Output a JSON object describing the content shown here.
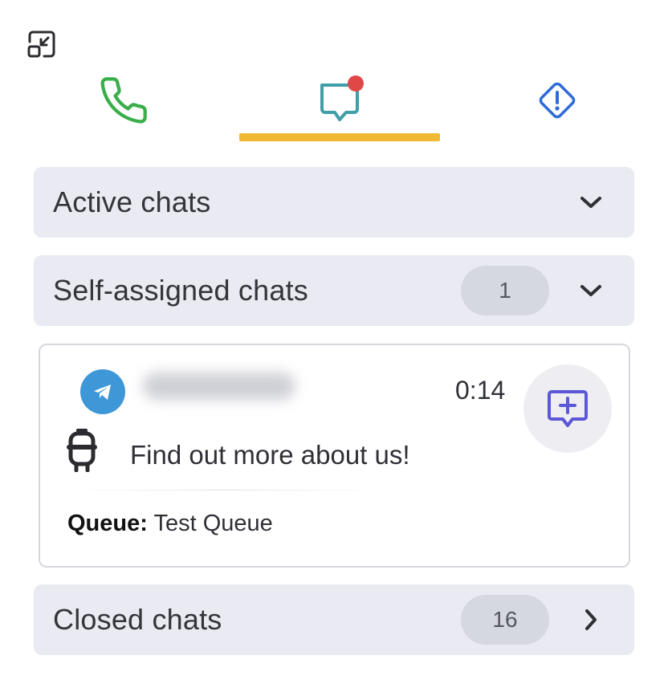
{
  "toolbar": {
    "collapse_icon": "minimize-window-icon"
  },
  "tabs": [
    {
      "name": "phone",
      "icon": "phone-icon",
      "color": "#3aae4a"
    },
    {
      "name": "chats",
      "icon": "chat-bubble-icon",
      "color": "#3f9ea8",
      "badge_color": "#e04848",
      "active": true
    },
    {
      "name": "alerts",
      "icon": "alert-diamond-icon",
      "color": "#2f6bd6"
    }
  ],
  "accent_color": "#f0b833",
  "sections": {
    "active": {
      "title": "Active chats",
      "expanded": false
    },
    "self_assigned": {
      "title": "Self-assigned chats",
      "count": "1",
      "expanded": true
    },
    "closed": {
      "title": "Closed chats",
      "count": "16",
      "expanded": false
    }
  },
  "chat_card": {
    "channel_icon": "telegram-icon",
    "time": "0:14",
    "bot_icon": "bot-icon",
    "message": "Find out more about us!",
    "queue_label": "Queue:",
    "queue_value": "Test Queue",
    "action_icon": "add-comment-icon",
    "action_color": "#5b57d6"
  }
}
